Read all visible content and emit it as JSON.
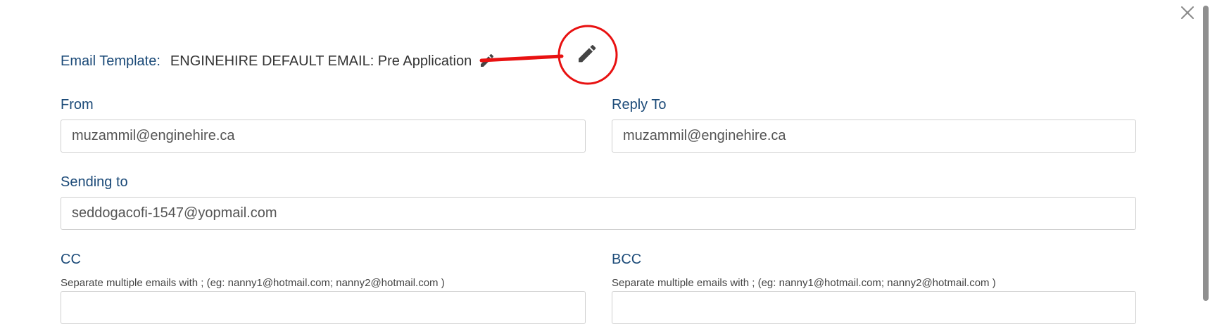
{
  "icons": {
    "close": "close-icon",
    "small_pencil": "pencil-icon",
    "annotated_pencil": "pencil-icon"
  },
  "colors": {
    "label": "#1b4a78",
    "annotation": "#e81111"
  },
  "template": {
    "label": "Email Template:",
    "value": "ENGINEHIRE DEFAULT EMAIL: Pre Application"
  },
  "from": {
    "label": "From",
    "value": "muzammil@enginehire.ca"
  },
  "reply_to": {
    "label": "Reply To",
    "value": "muzammil@enginehire.ca"
  },
  "sending_to": {
    "label": "Sending to",
    "value": "seddogacofi-1547@yopmail.com"
  },
  "cc": {
    "label": "CC",
    "hint": "Separate multiple emails with ; (eg: nanny1@hotmail.com; nanny2@hotmail.com )",
    "value": ""
  },
  "bcc": {
    "label": "BCC",
    "hint": "Separate multiple emails with ; (eg: nanny1@hotmail.com; nanny2@hotmail.com )",
    "value": ""
  }
}
